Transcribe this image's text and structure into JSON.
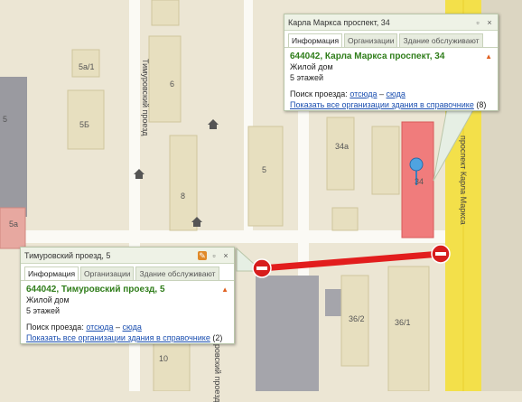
{
  "map": {
    "street_timurovsky": "Тимуровский проезд",
    "street_karla_marksa": "проспект Карла Маркса",
    "building_labels": [
      "5а/1",
      "5Б",
      "6",
      "8",
      "5",
      "5а",
      "34а",
      "36/2",
      "36/1",
      "10",
      "34",
      "5"
    ],
    "route_color": "#e21d1d",
    "road_color": "#f3e04a"
  },
  "popup_top": {
    "title": "Карла Маркса проспект, 34",
    "tabs": [
      "Информация",
      "Организации",
      "Здание обслуживают"
    ],
    "address": "644042, Карла Маркса проспект, 34",
    "type": "Жилой дом",
    "floors": "5 этажей",
    "route_label": "Поиск проезда:",
    "route_from": "отсюда",
    "route_sep": "–",
    "route_to": "сюда",
    "orgs_link": "Показать все организации здания в справочнике",
    "orgs_count": "(8)"
  },
  "popup_bottom": {
    "title": "Тимуровский проезд, 5",
    "tabs": [
      "Информация",
      "Организации",
      "Здание обслуживают"
    ],
    "address": "644042, Тимуровский проезд, 5",
    "type": "Жилой дом",
    "floors": "5 этажей",
    "route_label": "Поиск проезда:",
    "route_from": "отсюда",
    "route_sep": "–",
    "route_to": "сюда",
    "orgs_link": "Показать все организации здания в справочнике",
    "orgs_count": "(2)"
  }
}
